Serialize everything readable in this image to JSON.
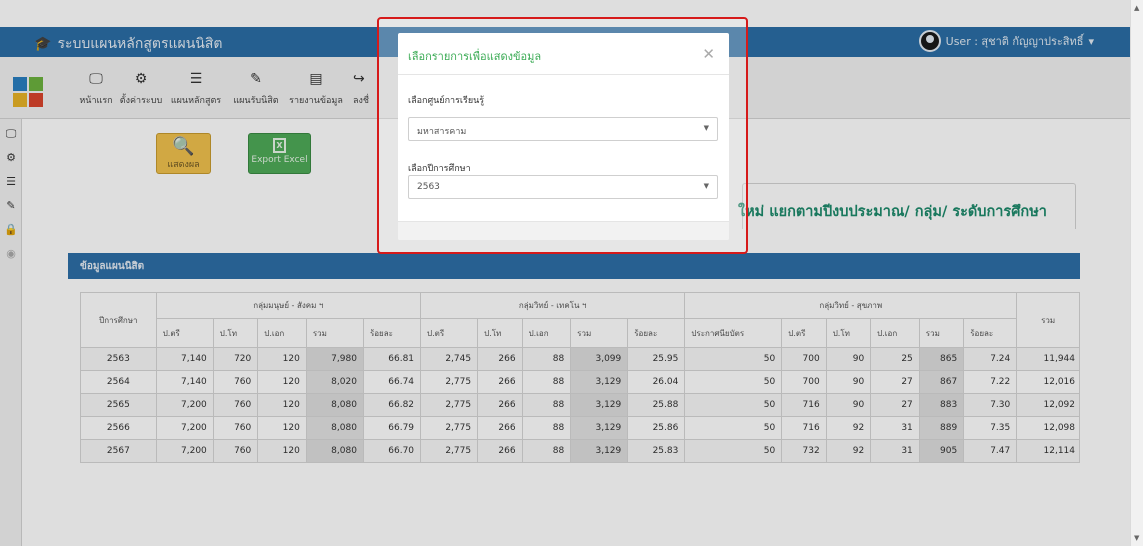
{
  "navbar": {
    "brand_icon": "graduation-cap-icon",
    "brand": "ระบบแผนหลักสูตรแผนนิสิต",
    "user": "User : สุชาติ กัญญาประสิทธิ์"
  },
  "toolbar": {
    "items": [
      {
        "label": "หน้าแรก",
        "icon": "monitor-icon"
      },
      {
        "label": "ตั้งค่าระบบ",
        "icon": "cogs-icon"
      },
      {
        "label": "แผนหลักสูตร",
        "icon": "list-icon"
      },
      {
        "label": "แผนรับนิสิต",
        "icon": "edit-icon"
      },
      {
        "label": "รายงานข้อมูล",
        "icon": "report-icon"
      },
      {
        "label": "ลงชื่",
        "icon": "signin-icon"
      }
    ]
  },
  "actions": {
    "show_label": "แสดงผล",
    "excel_label": "Export Excel"
  },
  "heading": "ใหม่ แยกตามปีงบประมาณ/ กลุ่ม/ ระดับการศึกษา",
  "panel": {
    "title": "ข้อมูลแผนนิสิต"
  },
  "table": {
    "year_header": "ปีการศึกษา",
    "total_header": "รวม",
    "groups": [
      "กลุ่มมนุษย์ - สังคม ฯ",
      "กลุ่มวิทย์ - เทคโน ฯ",
      "กลุ่มวิทย์ - สุขภาพ"
    ],
    "sub_headers": [
      "ป.ตรี",
      "ป.โท",
      "ป.เอก",
      "รวม",
      "ร้อยละ",
      "ป.ตรี",
      "ป.โท",
      "ป.เอก",
      "รวม",
      "ร้อยละ",
      "ประกาศนียบัตร",
      "ป.ตรี",
      "ป.โท",
      "ป.เอก",
      "รวม",
      "ร้อยละ"
    ],
    "rows": [
      [
        "2563",
        "7,140",
        "720",
        "120",
        "7,980",
        "66.81",
        "2,745",
        "266",
        "88",
        "3,099",
        "25.95",
        "50",
        "700",
        "90",
        "25",
        "865",
        "7.24",
        "11,944"
      ],
      [
        "2564",
        "7,140",
        "760",
        "120",
        "8,020",
        "66.74",
        "2,775",
        "266",
        "88",
        "3,129",
        "26.04",
        "50",
        "700",
        "90",
        "27",
        "867",
        "7.22",
        "12,016"
      ],
      [
        "2565",
        "7,200",
        "760",
        "120",
        "8,080",
        "66.82",
        "2,775",
        "266",
        "88",
        "3,129",
        "25.88",
        "50",
        "716",
        "90",
        "27",
        "883",
        "7.30",
        "12,092"
      ],
      [
        "2566",
        "7,200",
        "760",
        "120",
        "8,080",
        "66.79",
        "2,775",
        "266",
        "88",
        "3,129",
        "25.86",
        "50",
        "716",
        "92",
        "31",
        "889",
        "7.35",
        "12,098"
      ],
      [
        "2567",
        "7,200",
        "760",
        "120",
        "8,080",
        "66.70",
        "2,775",
        "266",
        "88",
        "3,129",
        "25.83",
        "50",
        "732",
        "92",
        "31",
        "905",
        "7.47",
        "12,114"
      ]
    ]
  },
  "modal": {
    "title": "เลือกรายการเพื่อแสดงข้อมูล",
    "center_label": "เลือกศูนย์การเรียนรู้",
    "center_value": "มหาสารคาม",
    "year_label": "เลือกปีการศึกษา",
    "year_value": "2563"
  },
  "colors": {
    "navbar": "#2b6ea6",
    "heading": "#1d8a6b",
    "highlight_frame": "#d61a1a",
    "modal_title": "#3bab55"
  }
}
